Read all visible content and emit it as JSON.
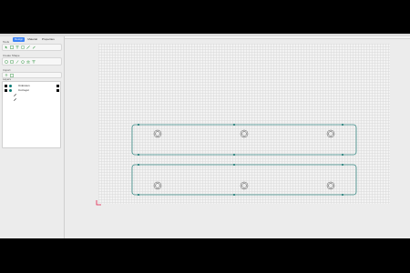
{
  "panel": {
    "tabs": [
      {
        "label": "Design"
      },
      {
        "label": "Material"
      },
      {
        "label": "Properties"
      }
    ],
    "sections": {
      "tools": "Tools",
      "create_shape": "Create Shape",
      "import": "Import",
      "layers": "Layers"
    },
    "tool_icons": {
      "row1": [
        "pointer-icon",
        "node-edit-icon",
        "text-icon",
        "image-icon",
        "measure-icon",
        "pen-icon"
      ],
      "row2": [
        "circle-icon",
        "rectangle-icon",
        "line-icon",
        "polygon-icon",
        "star-icon",
        "text-shape-icon"
      ],
      "row3": [
        "upload-icon",
        "library-icon"
      ]
    },
    "layers": [
      {
        "name": "Unknown"
      },
      {
        "name": "Cut layer"
      }
    ]
  },
  "colors": {
    "accent": "#3b82f6",
    "part_outline": "#3f8f8a",
    "origin_marker": "#e11d48"
  }
}
